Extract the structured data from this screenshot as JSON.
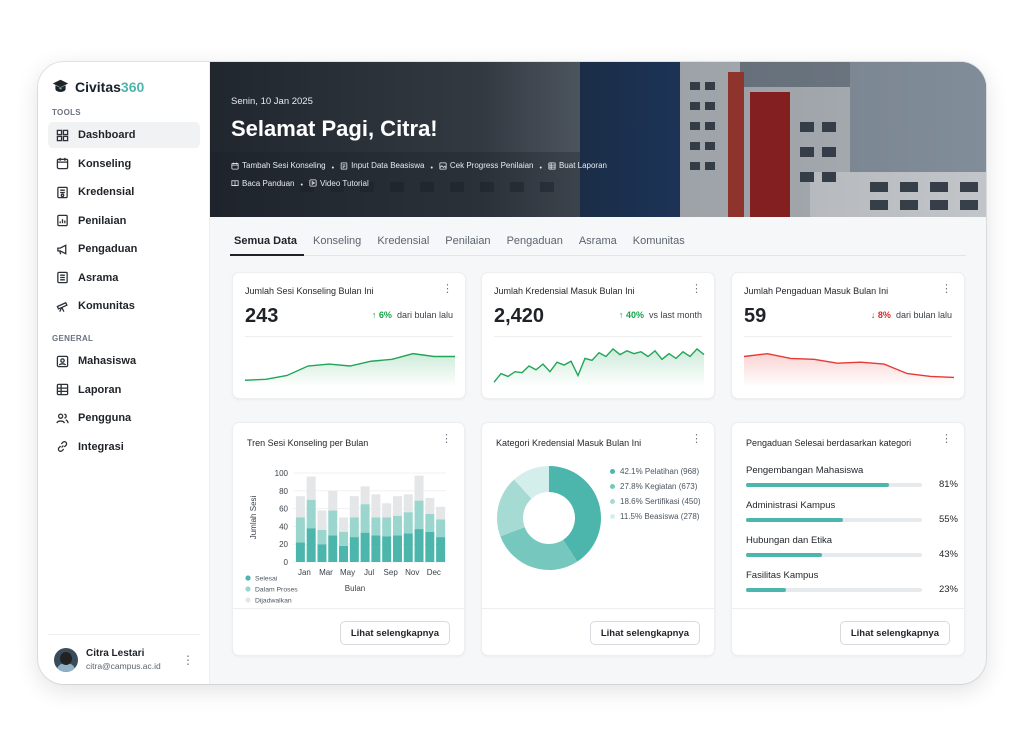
{
  "brand": {
    "name_main": "Civitas",
    "name_accent": "360",
    "accent_color": "#4db6ac"
  },
  "sidebar": {
    "tools_label": "TOOLS",
    "general_label": "GENERAL",
    "tools": [
      {
        "label": "Dashboard",
        "icon": "grid-icon",
        "active": true
      },
      {
        "label": "Konseling",
        "icon": "calendar-icon"
      },
      {
        "label": "Kredensial",
        "icon": "certificate-icon"
      },
      {
        "label": "Penilaian",
        "icon": "chart-doc-icon"
      },
      {
        "label": "Pengaduan",
        "icon": "megaphone-icon"
      },
      {
        "label": "Asrama",
        "icon": "building-icon"
      },
      {
        "label": "Komunitas",
        "icon": "telescope-icon"
      }
    ],
    "general": [
      {
        "label": "Mahasiswa",
        "icon": "id-card-icon"
      },
      {
        "label": "Laporan",
        "icon": "table-icon"
      },
      {
        "label": "Pengguna",
        "icon": "users-icon"
      },
      {
        "label": "Integrasi",
        "icon": "link-icon"
      }
    ],
    "user": {
      "name": "Citra Lestari",
      "email": "citra@campus.ac.id"
    }
  },
  "hero": {
    "date": "Senin, 10 Jan 2025",
    "greeting": "Selamat Pagi, Citra!",
    "links": [
      {
        "label": "Tambah Sesi Konseling",
        "icon": "calendar-icon"
      },
      {
        "label": "Input Data Beasiswa",
        "icon": "doc-icon"
      },
      {
        "label": "Cek Progress Penilaian",
        "icon": "image-icon"
      },
      {
        "label": "Buat Laporan",
        "icon": "table-icon"
      },
      {
        "label": "Baca Panduan",
        "icon": "book-icon"
      },
      {
        "label": "Video Tutorial",
        "icon": "play-icon"
      }
    ]
  },
  "tabs": [
    "Semua Data",
    "Konseling",
    "Kredensial",
    "Penilaian",
    "Pengaduan",
    "Asrama",
    "Komunitas"
  ],
  "stats": [
    {
      "title": "Jumlah Sesi Konseling Bulan Ini",
      "value": "243",
      "delta": "6%",
      "direction": "up",
      "suffix": "dari bulan lalu",
      "color": "#22a559",
      "spark": [
        5,
        6,
        10,
        20,
        22,
        20,
        25,
        27,
        33,
        30,
        30
      ]
    },
    {
      "title": "Jumlah Kredensial Masuk Bulan Ini",
      "value": "2,420",
      "delta": "40%",
      "direction": "up",
      "suffix": "vs last month",
      "color": "#22a559",
      "spark": [
        3,
        12,
        9,
        14,
        13,
        20,
        16,
        22,
        14,
        24,
        21,
        25,
        10,
        28,
        26,
        34,
        30,
        38,
        32,
        36,
        33,
        35,
        30,
        36,
        27,
        33,
        28,
        35,
        30,
        38,
        32
      ]
    },
    {
      "title": "Jumlah Pengaduan Masuk Bulan Ini",
      "value": "59",
      "delta": "8%",
      "direction": "down",
      "suffix": "dari bulan lalu",
      "color": "#e53935",
      "spark": [
        30,
        33,
        28,
        27,
        23,
        24,
        22,
        12,
        9,
        8
      ]
    }
  ],
  "bar_card": {
    "title": "Tren Sesi Konseling per Bulan",
    "button": "Lihat selengkapnya",
    "chart_data": {
      "type": "bar",
      "stacked": true,
      "xlabel": "Bulan",
      "ylabel": "Jumlah Sesi",
      "ylim": [
        0,
        100
      ],
      "yticks": [
        0,
        20,
        40,
        60,
        80,
        100
      ],
      "categories": [
        "Jan",
        "",
        "Mar",
        "",
        "May",
        "",
        "Jul",
        "",
        "Sep",
        "",
        "Nov",
        "",
        "Dec",
        ""
      ],
      "xtick_labels": [
        "Jan",
        "Mar",
        "May",
        "Jul",
        "Sep",
        "Nov",
        "Dec"
      ],
      "series": [
        {
          "name": "Selesai",
          "color": "#4db6ac",
          "values": [
            22,
            38,
            20,
            30,
            18,
            28,
            33,
            30,
            29,
            30,
            32,
            37,
            34,
            28
          ]
        },
        {
          "name": "Dalam Proses",
          "color": "#9ad6ce",
          "values": [
            28,
            32,
            16,
            28,
            16,
            22,
            32,
            20,
            21,
            22,
            24,
            32,
            20,
            20
          ]
        },
        {
          "name": "Dijadwalkan",
          "color": "#e4e6e8",
          "values": [
            24,
            26,
            22,
            22,
            16,
            24,
            20,
            26,
            16,
            22,
            20,
            28,
            18,
            14
          ]
        }
      ]
    }
  },
  "donut_card": {
    "title": "Kategori Kredensial Masuk Bulan Ini",
    "button": "Lihat selengkapnya",
    "chart_data": {
      "type": "pie",
      "donut": true,
      "slices": [
        {
          "label": "42.1% Pelatihan (968)",
          "value": 968,
          "color": "#4db6ac"
        },
        {
          "label": "27.8% Kegiatan (673)",
          "value": 673,
          "color": "#76c8bf"
        },
        {
          "label": "18.6% Sertifikasi (450)",
          "value": 450,
          "color": "#a6dbd4"
        },
        {
          "label": "11.5% Beasiswa (278)",
          "value": 278,
          "color": "#d4efeb"
        }
      ]
    }
  },
  "progress_card": {
    "title": "Pengaduan Selesai berdasarkan kategori",
    "button": "Lihat selengkapnya",
    "items": [
      {
        "label": "Pengembangan Mahasiswa",
        "value": 81,
        "pct": "81%"
      },
      {
        "label": "Administrasi Kampus",
        "value": 55,
        "pct": "55%"
      },
      {
        "label": "Hubungan dan Etika",
        "value": 43,
        "pct": "43%"
      },
      {
        "label": "Fasilitas Kampus",
        "value": 23,
        "pct": "23%"
      }
    ]
  }
}
